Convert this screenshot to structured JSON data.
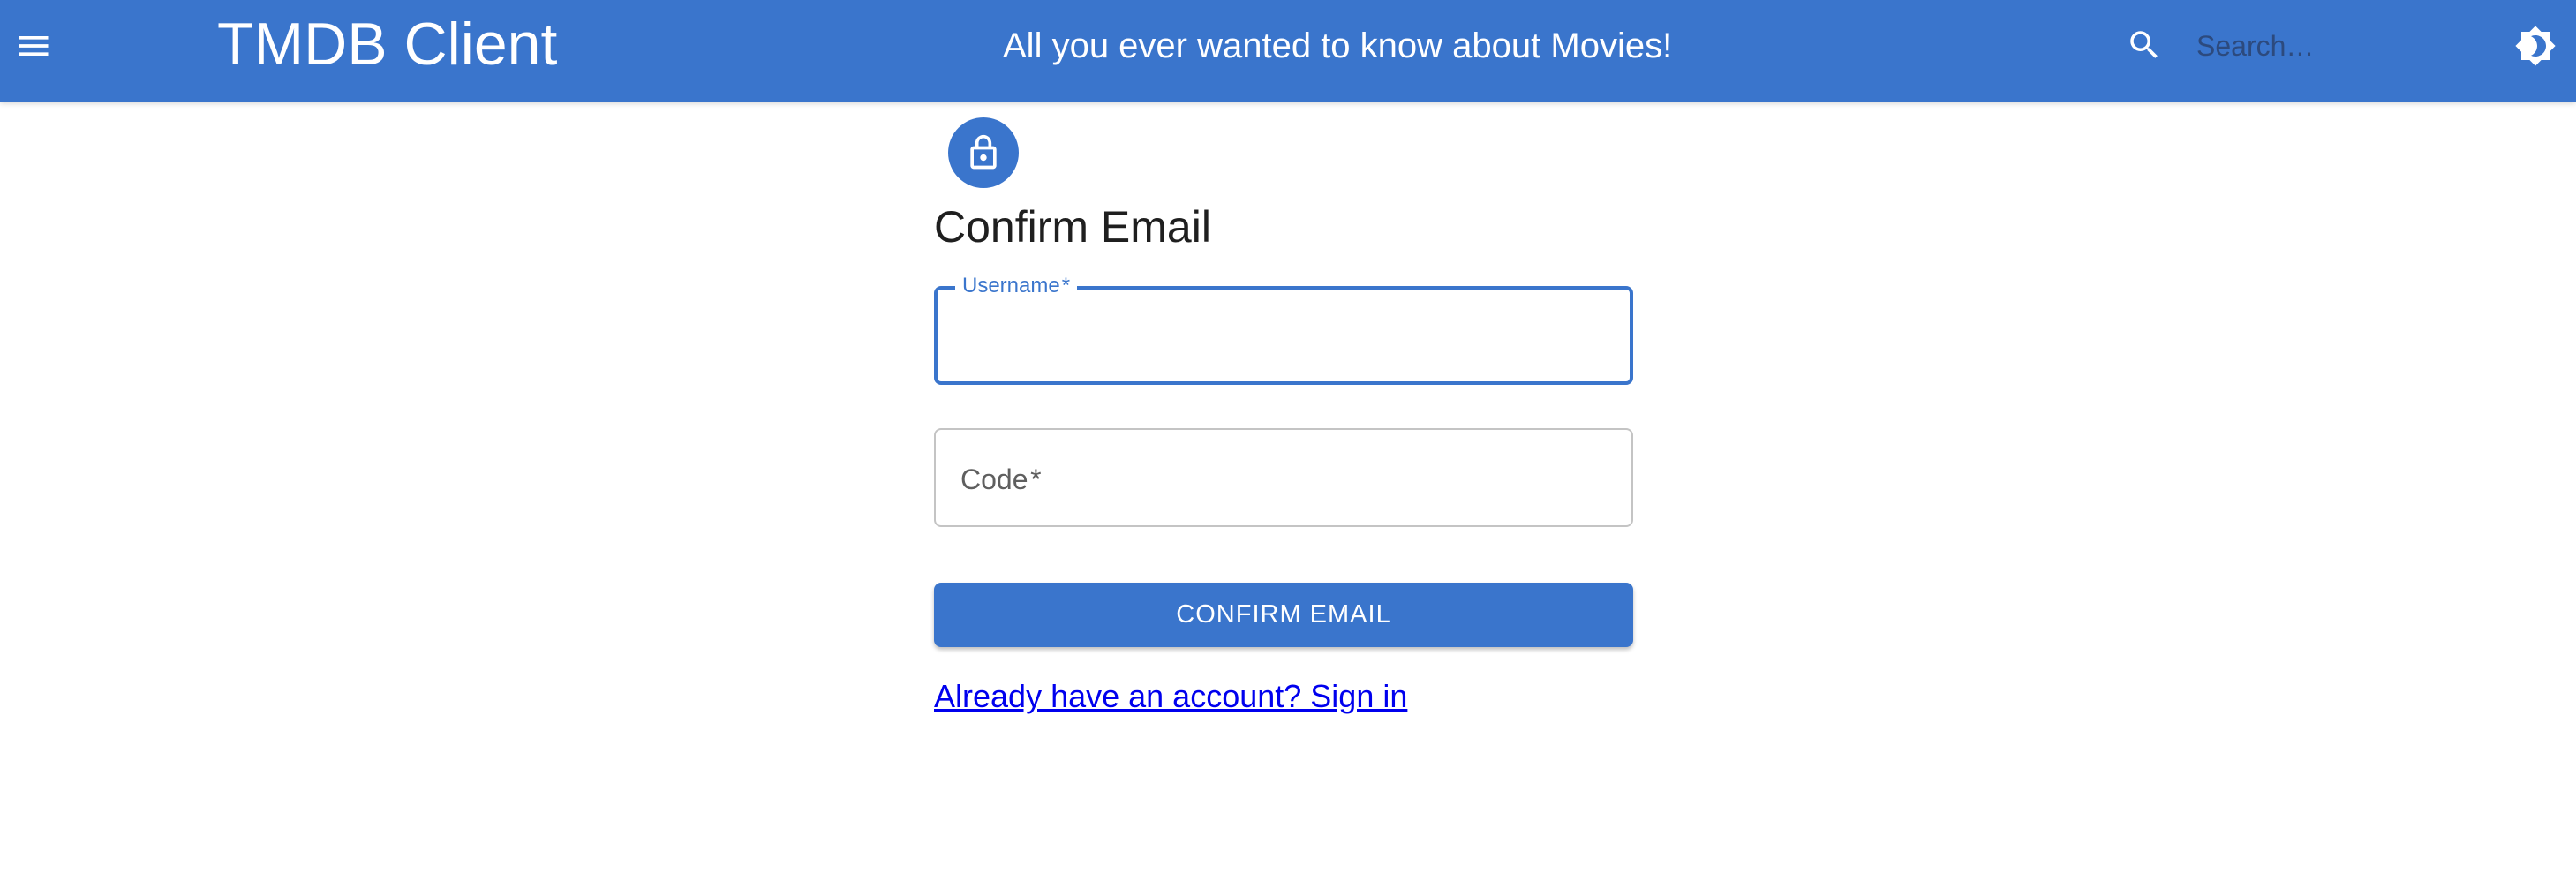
{
  "header": {
    "title": "TMDB Client",
    "tagline": "All you ever wanted to know about Movies!",
    "search_placeholder": "Search…",
    "menu_icon": "menu-icon",
    "search_icon": "search-icon",
    "theme_icon": "brightness-icon"
  },
  "form": {
    "avatar_icon": "lock-icon",
    "title": "Confirm Email",
    "username_label": "Username",
    "username_value": "",
    "code_label": "Code",
    "code_value": "",
    "required_mark": "*",
    "submit_label": "CONFIRM EMAIL",
    "signin_link": "Already have an account? Sign in"
  },
  "colors": {
    "primary": "#3a75cc",
    "link": "#0000ee",
    "text": "#1f1f1f",
    "border": "#c4c4c4"
  }
}
